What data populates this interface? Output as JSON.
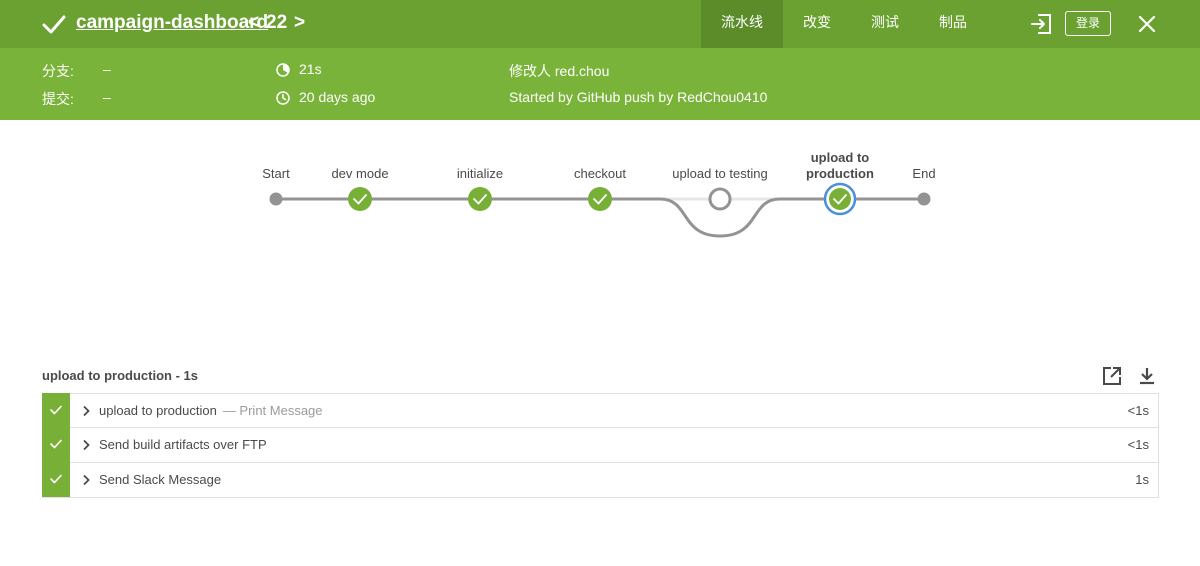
{
  "header": {
    "title": "campaign-dashboard",
    "run_number": "22",
    "prev_glyph": "<",
    "next_glyph": ">",
    "tabs": [
      {
        "label": "流水线",
        "active": true
      },
      {
        "label": "改变",
        "active": false
      },
      {
        "label": "测试",
        "active": false
      },
      {
        "label": "制品",
        "active": false
      }
    ],
    "login_label": "登录",
    "icons": {
      "status": "check-icon",
      "exit": "exit-icon",
      "close": "close-icon"
    }
  },
  "info": {
    "branch_label": "分支:",
    "branch_value": "–",
    "commit_label": "提交:",
    "commit_value": "–",
    "duration": "21s",
    "time_ago": "20 days ago",
    "changed_by": "修改人 red.chou",
    "trigger": "Started by GitHub push by RedChou0410"
  },
  "pipeline": {
    "stages": [
      {
        "label": "Start",
        "status": "start"
      },
      {
        "label": "dev mode",
        "status": "success"
      },
      {
        "label": "initialize",
        "status": "success"
      },
      {
        "label": "checkout",
        "status": "success"
      },
      {
        "label": "upload to testing",
        "status": "not-built"
      },
      {
        "label": "upload to\nproduction",
        "status": "success-selected"
      },
      {
        "label": "End",
        "status": "end"
      }
    ]
  },
  "steps": {
    "title": "upload to production - 1s",
    "items": [
      {
        "name": "upload to production",
        "sub": "— Print Message",
        "duration": "<1s"
      },
      {
        "name": "Send build artifacts over FTP",
        "sub": "",
        "duration": "<1s"
      },
      {
        "name": "Send Slack Message",
        "sub": "",
        "duration": "1s"
      }
    ]
  },
  "colors": {
    "topbar": "#6aa131",
    "infobar": "#7ab33a",
    "success": "#78b037",
    "selected_ring": "#4a90d9",
    "line": "#949393"
  }
}
